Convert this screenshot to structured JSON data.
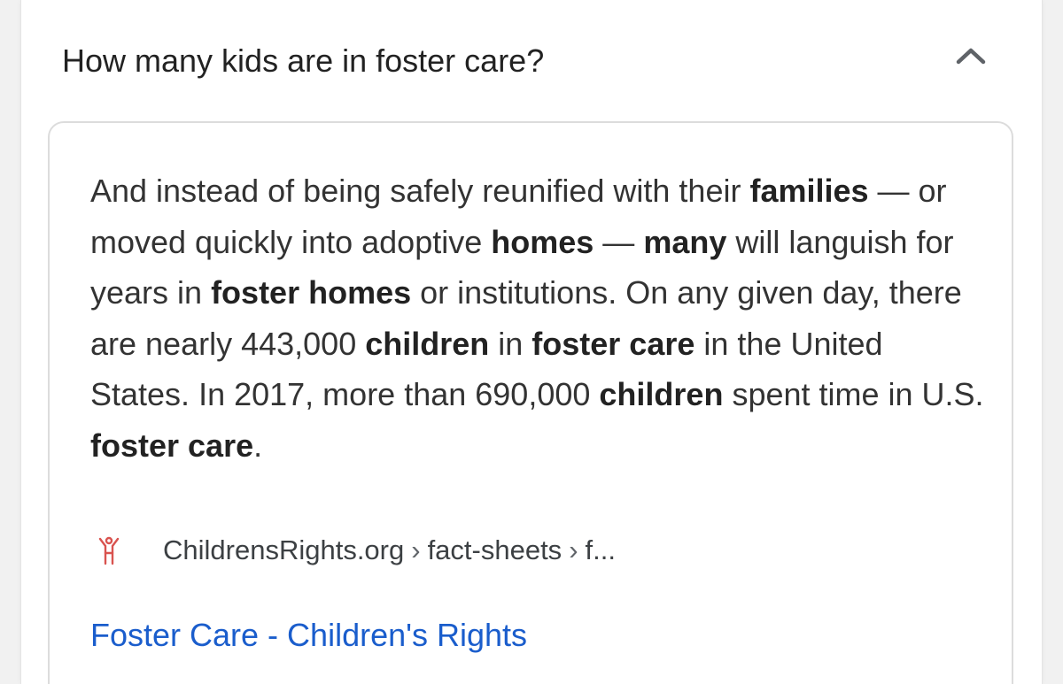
{
  "question": {
    "text": "How many kids are in foster care?",
    "toggle_icon": "chevron-up-icon"
  },
  "answer": {
    "segments": [
      {
        "text": "And instead of being safely reunified with their ",
        "bold": false
      },
      {
        "text": "families",
        "bold": true
      },
      {
        "text": " — or moved quickly into adoptive ",
        "bold": false
      },
      {
        "text": "homes",
        "bold": true
      },
      {
        "text": " — ",
        "bold": false
      },
      {
        "text": "many",
        "bold": true
      },
      {
        "text": " will languish for years in ",
        "bold": false
      },
      {
        "text": "foster homes",
        "bold": true
      },
      {
        "text": " or institutions. On any given day, there are nearly 443,000 ",
        "bold": false
      },
      {
        "text": "children",
        "bold": true
      },
      {
        "text": " in ",
        "bold": false
      },
      {
        "text": "foster care",
        "bold": true
      },
      {
        "text": " in the United States. In 2017, more than 690,000 ",
        "bold": false
      },
      {
        "text": "children",
        "bold": true
      },
      {
        "text": " spent time in U.S. ",
        "bold": false
      },
      {
        "text": "foster care",
        "bold": true
      },
      {
        "text": ".",
        "bold": false
      }
    ]
  },
  "source": {
    "favicon_icon": "childrens-rights-logo-icon",
    "site": "ChildrensRights.org",
    "separator": "›",
    "path_1": "fact-sheets",
    "path_2": "f..."
  },
  "result": {
    "title": "Foster Care - Children's Rights"
  },
  "colors": {
    "link": "#1a5dcc",
    "text": "#333333",
    "favicon": "#d9534f"
  }
}
